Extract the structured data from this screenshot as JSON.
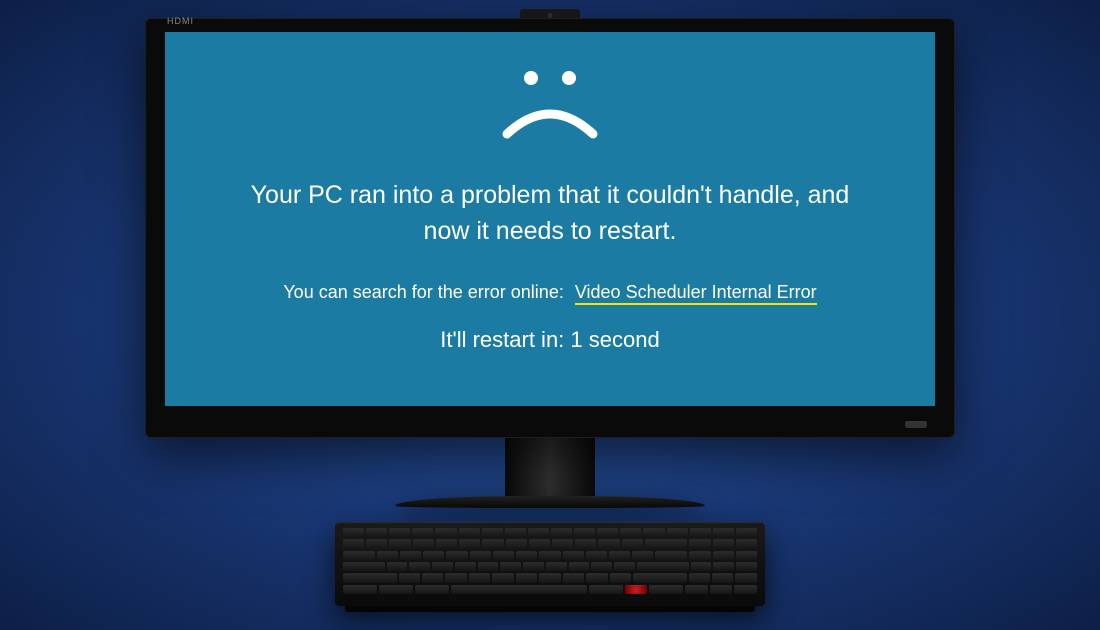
{
  "monitor": {
    "brand_label": "HDMI"
  },
  "bsod": {
    "main_message": "Your PC ran into a problem that it couldn't handle, and now it needs to restart.",
    "search_prompt": "You can search for the error online:",
    "error_name": "Video Scheduler Internal Error",
    "restart_label": "It'll restart in:",
    "restart_countdown": "1 second",
    "colors": {
      "screen_bg": "#1b7ba3",
      "text": "#ffffff",
      "underline": "#f5e400"
    }
  }
}
